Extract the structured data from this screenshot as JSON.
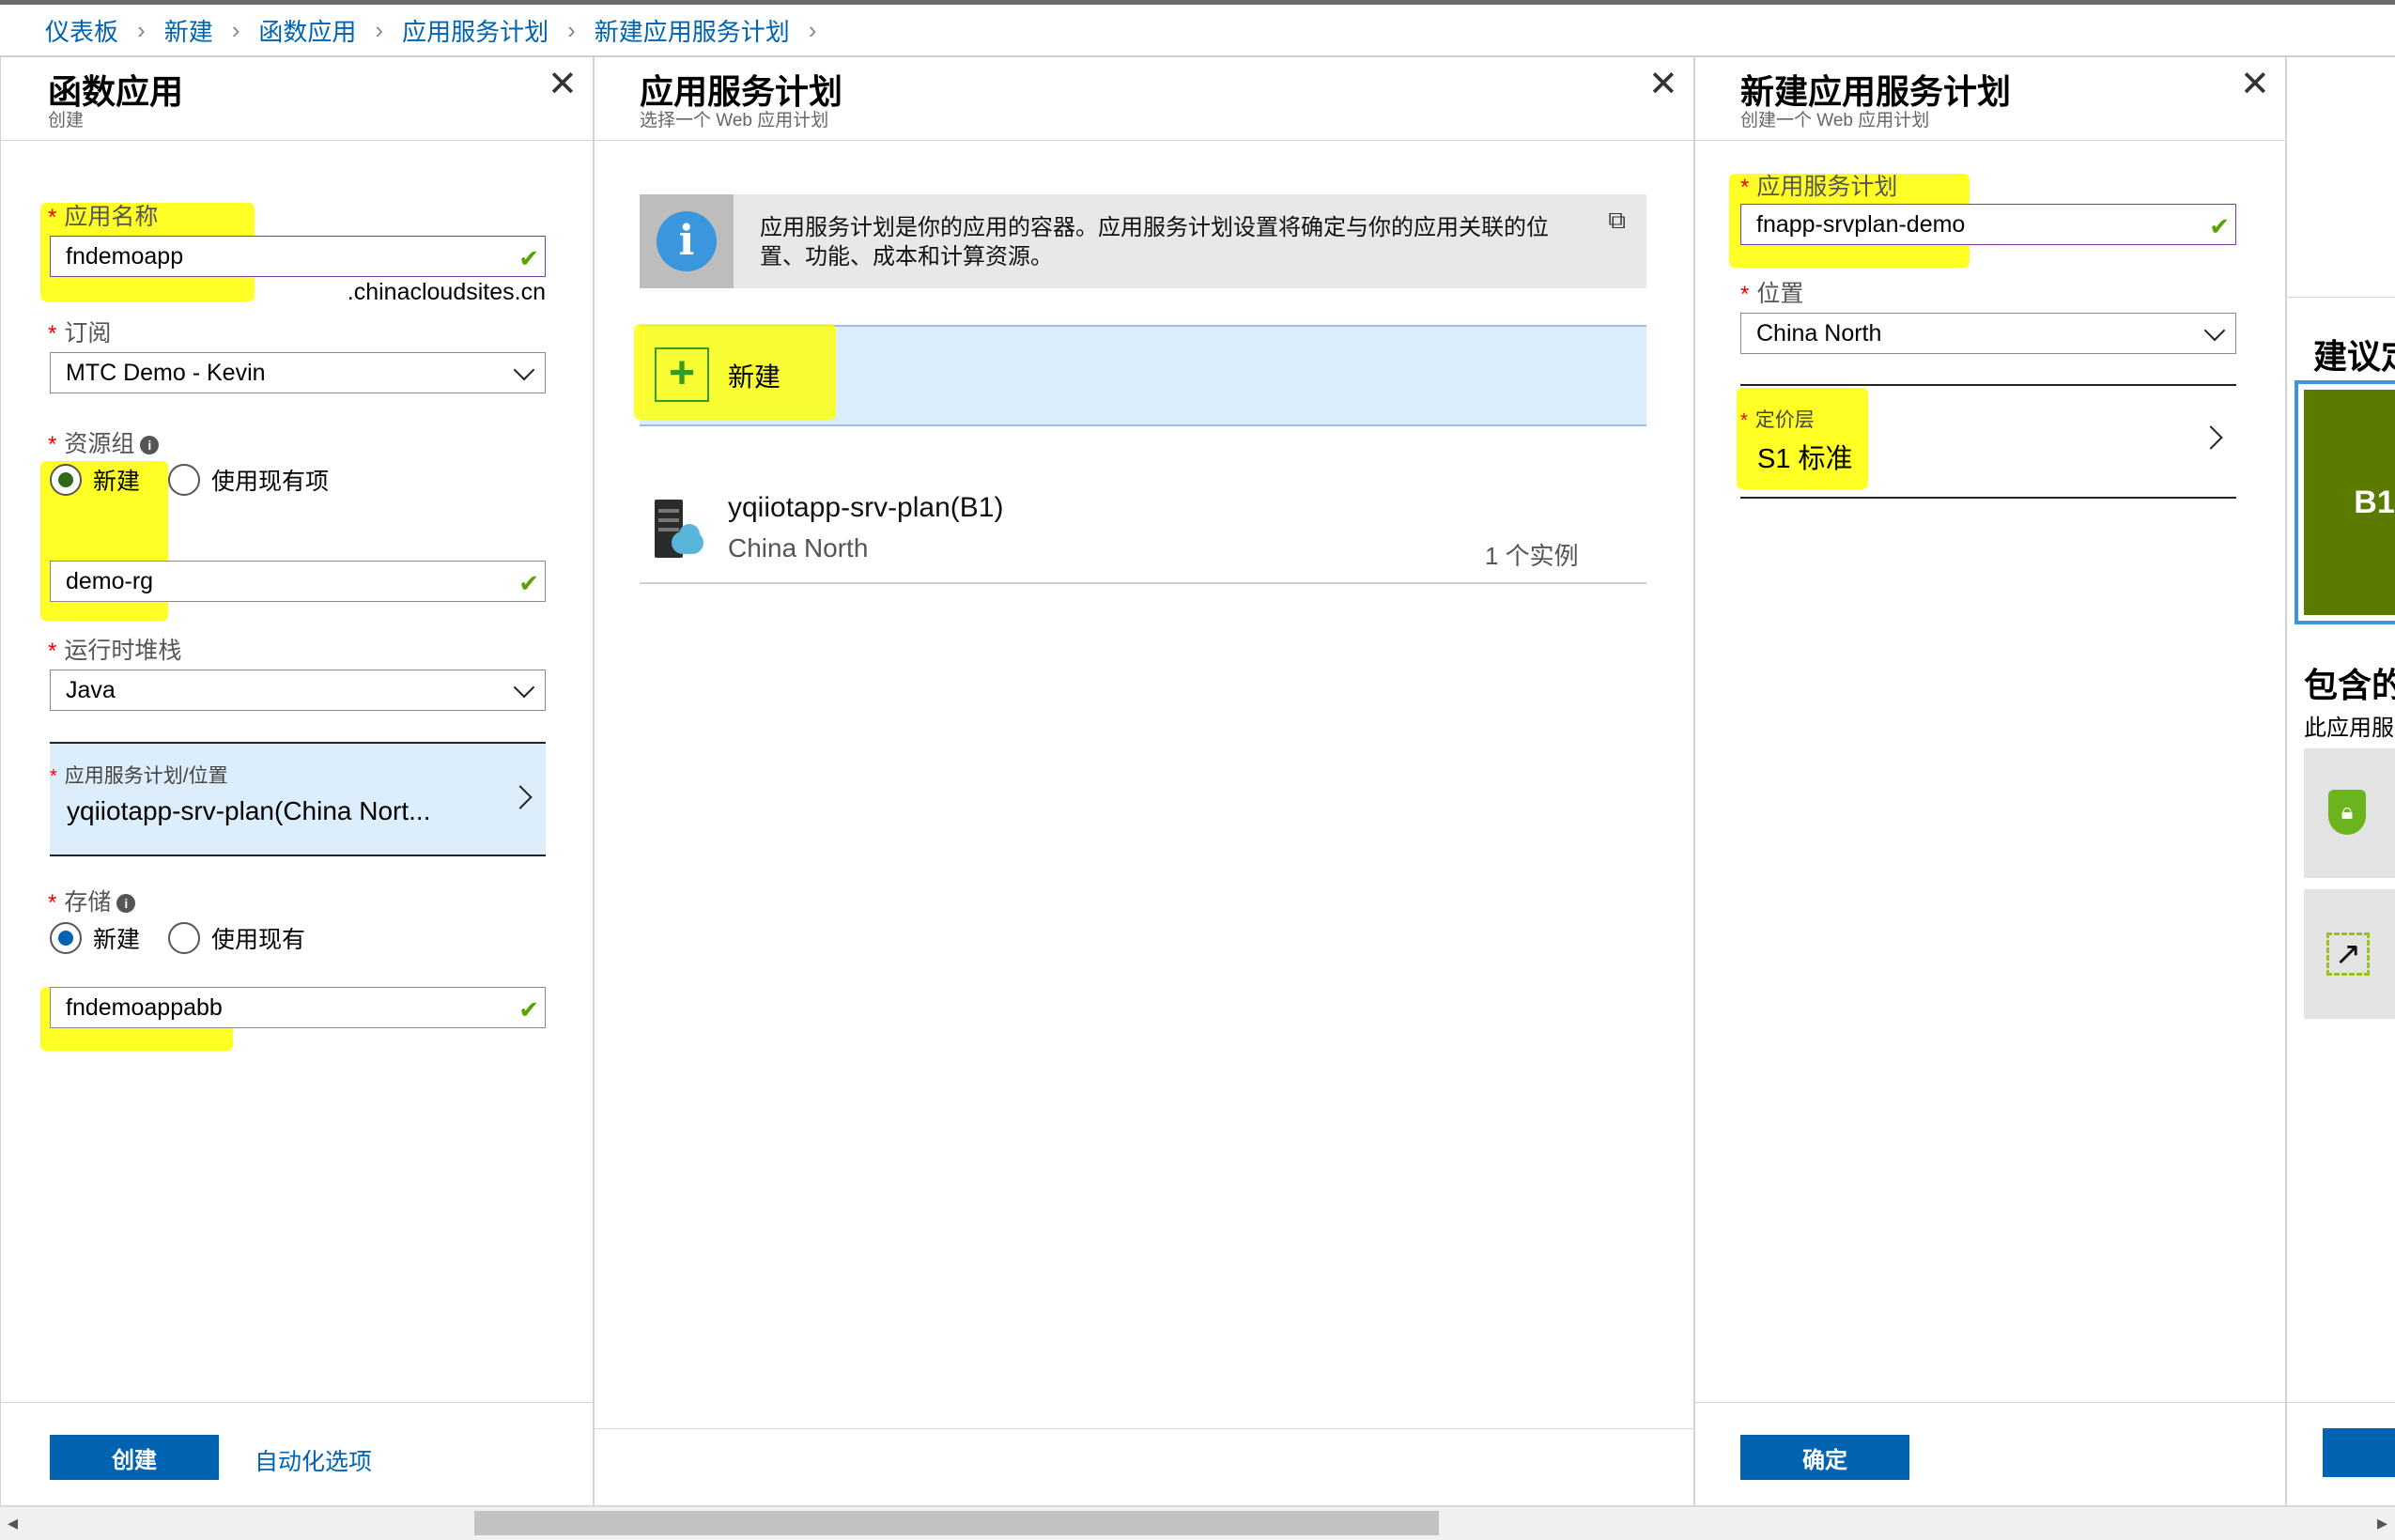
{
  "breadcrumb": [
    "仪表板",
    "新建",
    "函数应用",
    "应用服务计划",
    "新建应用服务计划"
  ],
  "panel_function_app": {
    "title": "函数应用",
    "subtitle": "创建",
    "app_name": {
      "label": "应用名称",
      "value": "fndemoapp",
      "suffix": ".chinacloudsites.cn"
    },
    "subscription": {
      "label": "订阅",
      "value": "MTC Demo - Kevin"
    },
    "resource_group": {
      "label": "资源组",
      "option_new": "新建",
      "option_existing": "使用现有项",
      "value": "demo-rg"
    },
    "runtime_stack": {
      "label": "运行时堆栈",
      "value": "Java"
    },
    "plan_location": {
      "label": "应用服务计划/位置",
      "value": "yqiiotapp-srv-plan(China Nort..."
    },
    "storage": {
      "label": "存储",
      "option_new": "新建",
      "option_existing": "使用现有",
      "value": "fndemoappabb"
    },
    "create_button": "创建",
    "automation_link": "自动化选项"
  },
  "panel_app_service_plan": {
    "title": "应用服务计划",
    "subtitle": "选择一个 Web 应用计划",
    "info_text_line1": "应用服务计划是你的应用的容器。应用服务计划设置将确定与你的应用关联的位",
    "info_text_line2": "置、功能、成本和计算资源。",
    "new_label": "新建",
    "plans": [
      {
        "name": "yqiiotapp-srv-plan(B1)",
        "region": "China North",
        "instances": "1 个实例"
      }
    ]
  },
  "panel_new_plan": {
    "title": "新建应用服务计划",
    "subtitle": "创建一个 Web 应用计划",
    "plan_name": {
      "label": "应用服务计划",
      "value": "fnapp-srvplan-demo"
    },
    "location": {
      "label": "位置",
      "value": "China North"
    },
    "pricing_tier": {
      "label": "定价层",
      "value": "S1 标准"
    },
    "ok_button": "确定"
  },
  "panel_pricing": {
    "recommended_heading": "建议定",
    "tier_badge": "B1",
    "included_heading": "包含的",
    "included_sub": "此应用服"
  },
  "colors": {
    "accent": "#0063b1",
    "highlight": "#ffff00",
    "tier_green": "#5a7a00",
    "selected_blue": "#dcedfc",
    "check_green": "#57a300"
  }
}
